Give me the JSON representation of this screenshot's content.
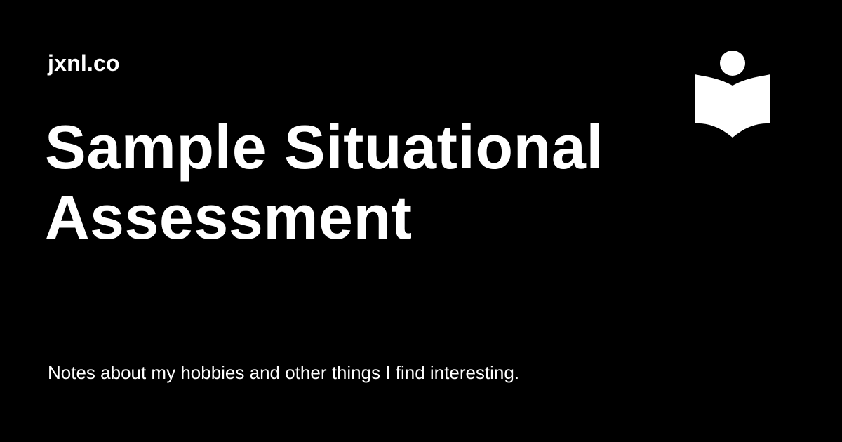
{
  "site": {
    "name": "jxnl.co"
  },
  "page": {
    "title_line1": "Sample Situational",
    "title_line2": "Assessment",
    "description": "Notes about my hobbies and other things I find interesting."
  },
  "logo": {
    "icon": "reader-book-icon",
    "color": "#ffffff"
  },
  "theme": {
    "background": "#000000",
    "text": "#ffffff"
  }
}
